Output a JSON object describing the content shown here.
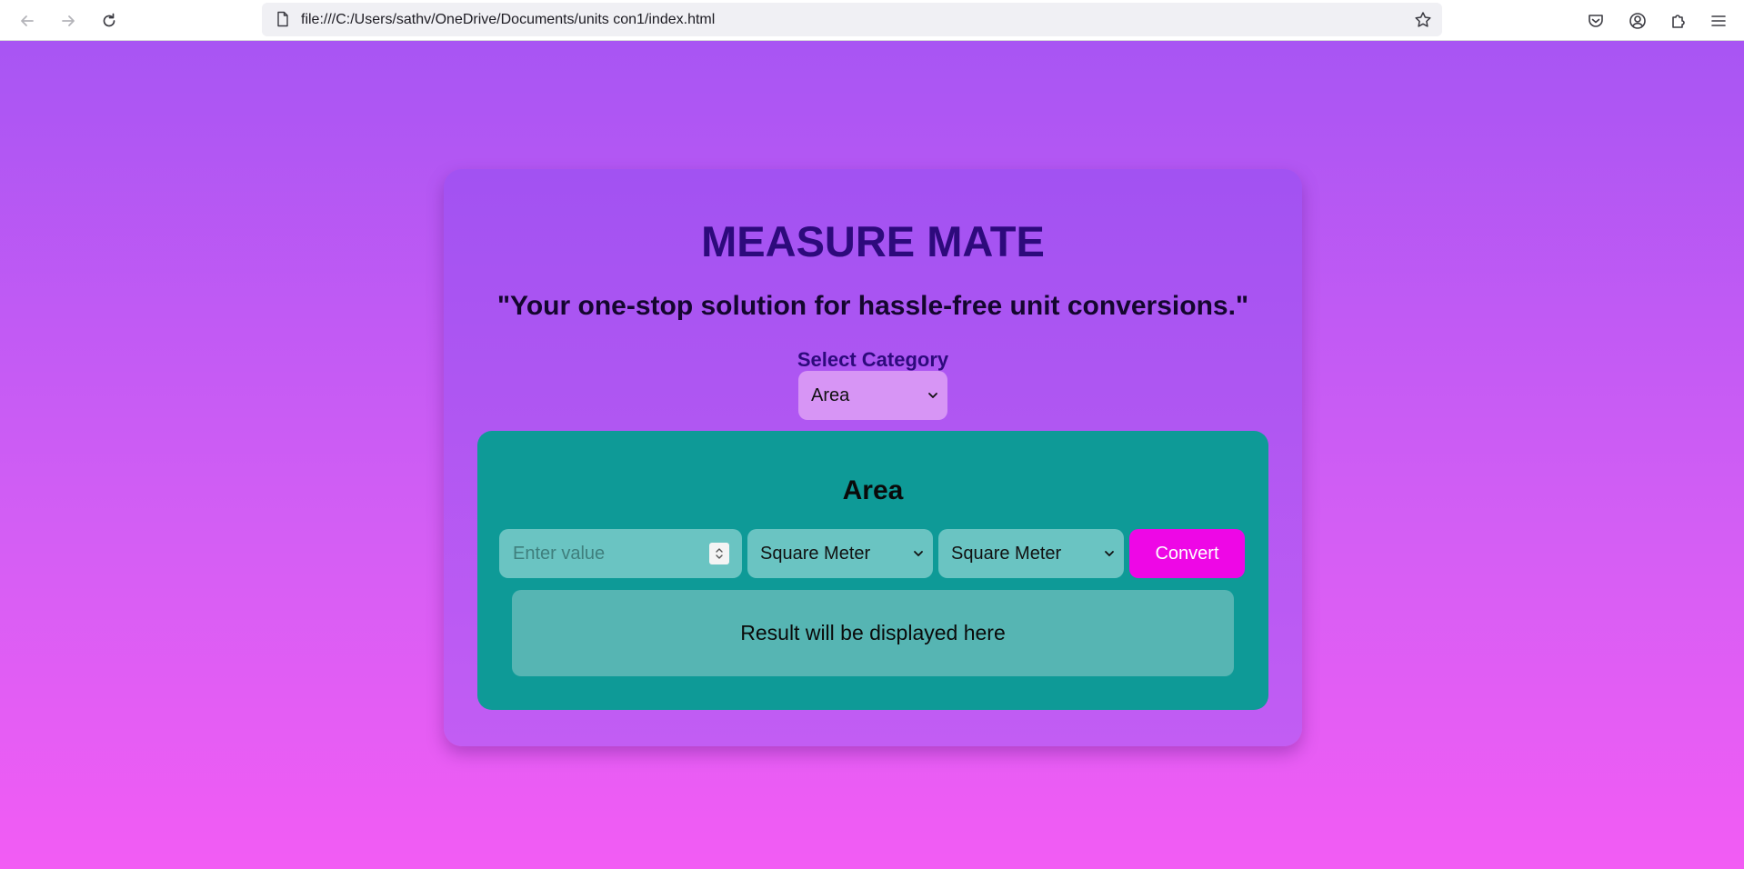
{
  "browser": {
    "url": "file:///C:/Users/sathv/OneDrive/Documents/units con1/index.html",
    "icons": {
      "back": "back-arrow-icon",
      "forward": "forward-arrow-icon",
      "reload": "reload-icon",
      "page": "page-icon",
      "bookmark": "star-icon",
      "pocket": "pocket-icon",
      "account": "account-icon",
      "extensions": "extensions-icon",
      "menu": "hamburger-menu-icon"
    }
  },
  "app": {
    "title": "MEASURE MATE",
    "tagline": "\"Your one-stop solution for hassle-free unit conversions.\"",
    "category_label": "Select Category",
    "category_selected": "Area"
  },
  "converter": {
    "title": "Area",
    "input_placeholder": "Enter value",
    "from_unit": "Square Meter",
    "to_unit": "Square Meter",
    "convert_label": "Convert",
    "result_text": "Result will be displayed here"
  },
  "colors": {
    "page_gradient_top": "#a855f3",
    "page_gradient_bottom": "#f25cf4",
    "title": "#2d0a7c",
    "panel": "#0e9a97",
    "convert_button": "#ee07e6"
  }
}
